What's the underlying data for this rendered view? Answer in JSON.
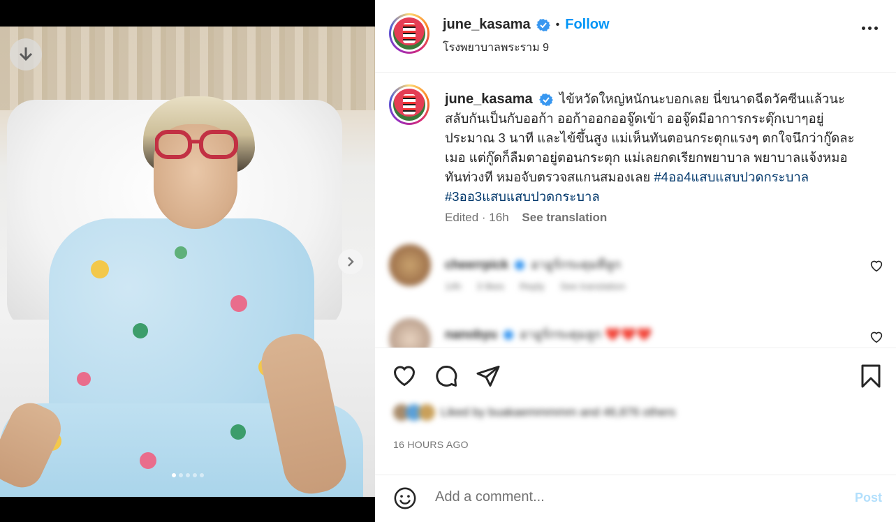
{
  "post": {
    "username": "june_kasama",
    "follow_label": "Follow",
    "bullet": "•",
    "location": "โรงพยาบาลพระราม 9",
    "caption_text": "ไข้หวัดใหญ่หนักนะบอกเลย นี่ขนาดฉีดวัคซีนแล้วนะ สลับกันเป็นกับออก้า ออก้าออกออจู๊ดเข้า ออจู๊ดมีอาการกระตุ๊กเบาๆอยู่ประมาณ 3 นาที และไข้ขึ้นสูง แม่เห็นทันตอนกระตุกแรงๆ ตกใจนึกว่ากู๊ดละเมอ แต่กู๊ดก็ลืมตาอยู่ตอนกระตุก แม่เลยกดเรียกพยาบาล พยาบาลแจ้งหมอทันท่วงที หมอจับตรวจสแกนสมองเลย ",
    "hashtag_1": "#4ออ4แสบแสบปวดกระบาล",
    "hashtag_2": "#3ออ3แสบแสบปวดกระบาล",
    "edited": "Edited · 16h",
    "see_translation": "See translation",
    "timestamp": "16 HOURS AGO"
  },
  "comments": [
    {
      "username": "cheerrpick",
      "text": "อาอูร์กระดุมทีลูก",
      "meta_age": "14h",
      "meta_likes": "3 likes",
      "meta_reply": "Reply",
      "meta_translate": "See translation"
    },
    {
      "username": "nanobyu",
      "text": "อาอูร์กระดุมลูก",
      "emoji": "❤️❤️❤️"
    }
  ],
  "likes_text": "Liked by buakaemmmmm and 46,876 others",
  "comment_box": {
    "placeholder": "Add a comment...",
    "post_label": "Post"
  },
  "colors": {
    "accent": "#0095f6",
    "hashtag": "#00376b",
    "muted": "#737373",
    "post_disabled": "#b2dffc"
  },
  "icons": [
    "download-icon",
    "chevron-right-icon",
    "verified-badge-icon",
    "more-options-icon",
    "heart-icon",
    "comment-icon",
    "share-icon",
    "bookmark-icon",
    "emoji-icon"
  ],
  "carousel": {
    "total": 5,
    "active": 1
  }
}
